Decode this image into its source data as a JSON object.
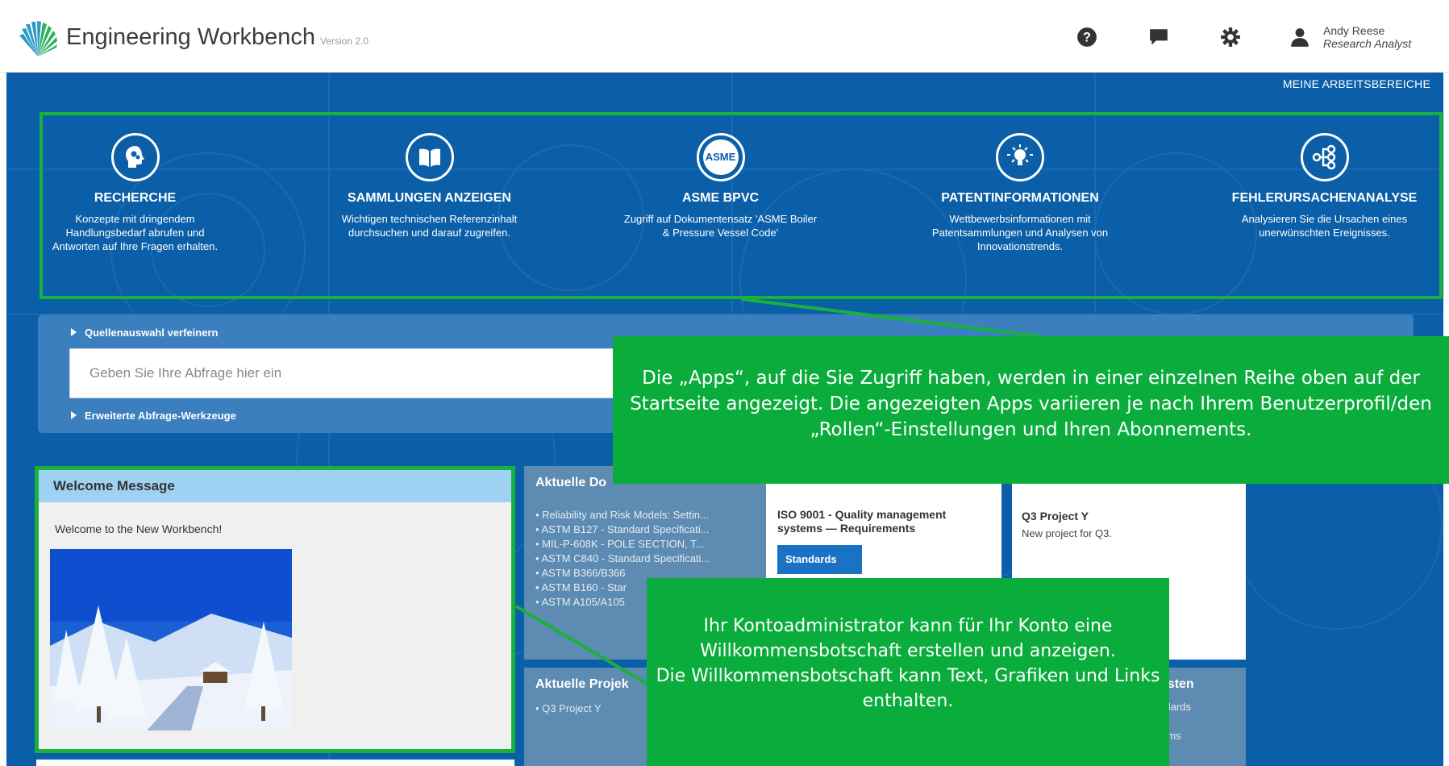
{
  "header": {
    "title": "Engineering Workbench",
    "version": "Version 2.0",
    "user_name": "Andy Reese",
    "user_role": "Research Analyst",
    "icons": [
      "help-icon",
      "chat-icon",
      "gear-icon",
      "user-icon"
    ]
  },
  "nav": {
    "workspaces": "MEINE ARBEITSBEREICHE"
  },
  "apps": [
    {
      "icon": "brain-gears-icon",
      "title": "RECHERCHE",
      "desc": "Konzepte mit dringendem Handlungsbedarf abrufen und Antworten auf Ihre Fragen erhalten."
    },
    {
      "icon": "book-icon",
      "title": "SAMMLUNGEN ANZEIGEN",
      "desc": "Wichtigen technischen Referenzinhalt durchsuchen und darauf zugreifen."
    },
    {
      "icon": "asme-icon",
      "title": "ASME BPVC",
      "desc": "Zugriff auf Dokumentensatz 'ASME Boiler & Pressure Vessel Code'"
    },
    {
      "icon": "lightbulb-icon",
      "title": "PATENTINFORMATIONEN",
      "desc": "Wettbewerbsinformationen mit Patentsammlungen und Analysen von Innovationstrends."
    },
    {
      "icon": "network-icon",
      "title": "FEHLERURSACHENANALYSE",
      "desc": "Analysieren Sie die Ursachen eines unerwünschten Ereignisses."
    }
  ],
  "asme_label": "ASME",
  "search": {
    "refine": "Quellenauswahl verfeinern",
    "placeholder": "Geben Sie Ihre Abfrage hier ein",
    "advanced": "Erweiterte Abfrage-Werkzeuge"
  },
  "welcome": {
    "title": "Welcome Message",
    "text": "Welcome to the New Workbench!"
  },
  "docs": {
    "title": "Aktuelle Do",
    "items": [
      "Reliability and Risk Models: Settin...",
      "ASTM B127 - Standard Specificati...",
      "MIL-P-608K - POLE SECTION, T...",
      "ASTM C840 - Standard Specificati...",
      "ASTM B366/B366",
      "ASTM B160 - Star",
      "ASTM A105/A105"
    ]
  },
  "iso": {
    "title": "ISO 9001 - Quality management systems — Requirements",
    "tag": "Standards"
  },
  "project": {
    "title": "Q3 Project Y",
    "desc": "New project for Q3."
  },
  "projects": {
    "title": "Aktuelle Projek",
    "items": [
      "Q3 Project Y"
    ]
  },
  "lists": {
    "title": "slisten",
    "items": [
      "andards",
      "e",
      "stems"
    ]
  },
  "callouts": {
    "apps": "Die „Apps“, auf die Sie Zugriff haben, werden in einer einzelnen Reihe oben auf der Startseite angezeigt. Die angezeigten Apps variieren je nach Ihrem Benutzerprofil/den „Rollen“-Einstellungen und Ihren Abonnements.",
    "welcome_line1": "Ihr Kontoadministrator kann für Ihr Konto eine Willkommensbotschaft erstellen und anzeigen.",
    "welcome_line2": "Die Willkommensbotschaft kann Text, Grafiken und Links enthalten."
  },
  "colors": {
    "primary": "#0b5fa8",
    "highlight": "#19b13b",
    "callout": "#0aad3c",
    "panel": "#5d8bb1"
  }
}
